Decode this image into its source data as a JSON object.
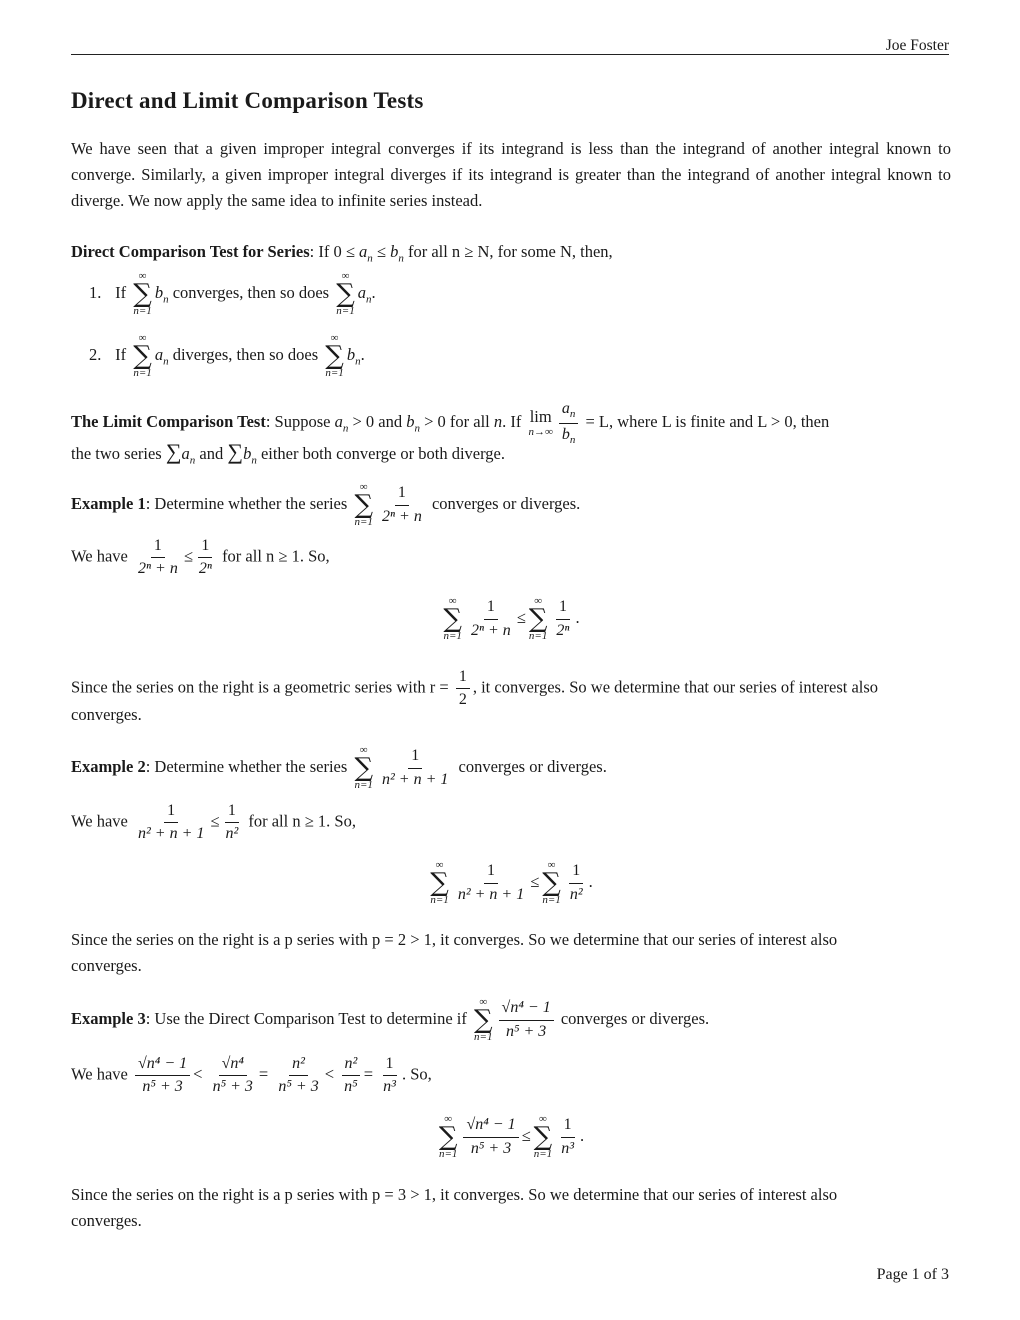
{
  "header": {
    "author": "Joe Foster"
  },
  "title": "Direct and Limit Comparison Tests",
  "intro": "We have seen that a given improper integral converges if its integrand is less than the integrand of another integral known to converge. Similarly, a given improper integral diverges if its integrand is greater than the integrand of another integral known to diverge. We now apply the same idea to infinite series instead.",
  "direct_test": {
    "label": "Direct Comparison Test for Series",
    "statement_pre": ": If 0 ≤ ",
    "statement_rest": "for all n ≥ N, for some N, then,",
    "items": [
      {
        "num": "1.",
        "pre": "If",
        "first_term": "b",
        "mid": "converges, then so does",
        "second_term": "a",
        "end": "."
      },
      {
        "num": "2.",
        "pre": "If",
        "first_term": "a",
        "mid": "diverges, then so does",
        "second_term": "b",
        "end": "."
      }
    ]
  },
  "limit_test": {
    "label": "The Limit Comparison Test",
    "line1_a": ": Suppose",
    "line1_b": "> 0 and",
    "line1_c": "> 0 for all",
    "line1_d": ". If",
    "lim_word": "lim",
    "lim_sub": "n→∞",
    "line1_e": "= L, where L is finite and L > 0, then",
    "line2_a": "the two series",
    "line2_b": "and",
    "line2_c": "either both converge or both diverge."
  },
  "sum_limits": {
    "top": "∞",
    "bottom": "n=1",
    "sigma": "∑"
  },
  "examples": [
    {
      "label": "Example 1",
      "prompt_pre": ": Determine whether the series",
      "prompt_post": "converges or diverges.",
      "series_num": "1",
      "series_den": "2ⁿ + n",
      "compare_pre": "We have",
      "compare_rhs_num": "1",
      "compare_rhs_den": "2ⁿ",
      "compare_post": "for all n ≥ 1. So,",
      "conclusion_pre": "Since the series on the right is a geometric series with r =",
      "r_num": "1",
      "r_den": "2",
      "conclusion_post": ", it converges. So we determine that our series of interest also",
      "conclusion_end": "converges."
    },
    {
      "label": "Example 2",
      "prompt_pre": ": Determine whether the series",
      "prompt_post": "converges or diverges.",
      "series_num": "1",
      "series_den": "n² + n + 1",
      "compare_pre": "We have",
      "compare_rhs_num": "1",
      "compare_rhs_den": "n²",
      "compare_post": "for all n ≥ 1. So,",
      "conclusion": "Since the series on the right is a p series with p = 2 > 1, it converges. So we determine that our series of interest also",
      "conclusion_end": "converges."
    },
    {
      "label": "Example 3",
      "prompt_pre": ": Use the Direct Comparison Test to determine if",
      "prompt_post": "converges or diverges.",
      "series_num": "√n⁴ − 1",
      "series_den": "n⁵ + 3",
      "compare_pre": "We have",
      "chain": [
        {
          "num": "√n⁴ − 1",
          "den": "n⁵ + 3",
          "op": "<"
        },
        {
          "num": "√n⁴",
          "den": "n⁵ + 3",
          "op": "="
        },
        {
          "num": "n²",
          "den": "n⁵ + 3",
          "op": "<"
        },
        {
          "num": "n²",
          "den": "n⁵",
          "op": "="
        },
        {
          "num": "1",
          "den": "n³",
          "op": ""
        }
      ],
      "compare_post": ". So,",
      "rhs_num": "1",
      "rhs_den": "n³",
      "conclusion": "Since the series on the right is a p series with p = 3 > 1, it converges. So we determine that our series of interest also",
      "conclusion_end": "converges."
    }
  ],
  "symbols": {
    "leq": "≤",
    "period": "."
  },
  "footer": {
    "page": "Page 1 of 3"
  }
}
